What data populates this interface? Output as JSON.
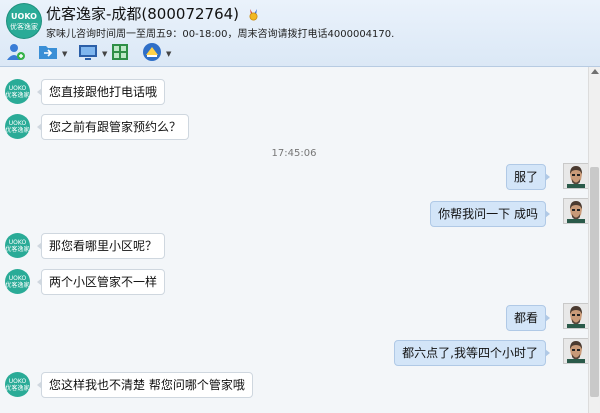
{
  "header": {
    "title": "优客逸家-成都(800072764)",
    "subtitle": "家味儿咨询时间周一至周五9：00-18:00，周末咨询请拨打电话4000004170.",
    "logo_text_1": "UOKO",
    "logo_text_2": "优客逸家",
    "badge_icon": "medal-icon"
  },
  "toolbar": {
    "icons": [
      "add-contact-icon",
      "folder-icon",
      "screen-icon",
      "apps-grid-icon",
      "profile-icon"
    ]
  },
  "chat": {
    "timestamp": "17:45:06",
    "messages": [
      {
        "side": "left",
        "text": "您直接跟他打电话哦"
      },
      {
        "side": "left",
        "text": "您之前有跟管家预约么？"
      },
      {
        "side": "right",
        "text": "服了"
      },
      {
        "side": "right",
        "text": "你帮我问一下  成吗"
      },
      {
        "side": "left",
        "text": "那您看哪里小区呢？"
      },
      {
        "side": "left",
        "text": "两个小区管家不一样"
      },
      {
        "side": "right",
        "text": "都看"
      },
      {
        "side": "right",
        "text": "都六点了,我等四个小时了"
      },
      {
        "side": "left",
        "text": "您这样我也不清楚 帮您问哪个管家哦"
      }
    ],
    "avatar_label": "UOKO 优客逸家"
  },
  "colors": {
    "accent": "#2aab97",
    "bubble_right": "#d3e5f8",
    "header_bg": "#dbe8f6"
  }
}
